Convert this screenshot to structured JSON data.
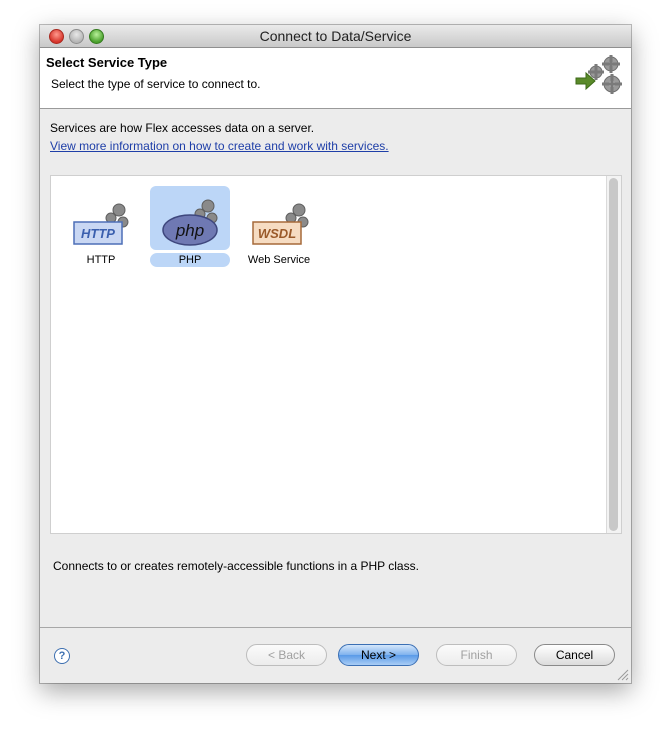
{
  "window": {
    "title": "Connect to Data/Service"
  },
  "header": {
    "title": "Select Service Type",
    "subtitle": "Select the type of service to connect to."
  },
  "intro": {
    "text": "Services are how Flex accesses data on a server.",
    "link": "View more information on how to create and work with services."
  },
  "services": [
    {
      "label": "HTTP",
      "icon": "http-gear-icon",
      "selected": false
    },
    {
      "label": "PHP",
      "icon": "php-gear-icon",
      "selected": true
    },
    {
      "label": "Web Service",
      "icon": "wsdl-gear-icon",
      "selected": false
    }
  ],
  "icon_text": {
    "http": "HTTP",
    "php": "php",
    "wsdl": "WSDL"
  },
  "description": "Connects to or creates remotely-accessible functions in a PHP class.",
  "buttons": {
    "help": "?",
    "back": "< Back",
    "next": "Next >",
    "finish": "Finish",
    "cancel": "Cancel"
  },
  "colors": {
    "selection": "#bcd6f7",
    "link": "#1f3fa8",
    "default_button": "#5a9ae8"
  }
}
